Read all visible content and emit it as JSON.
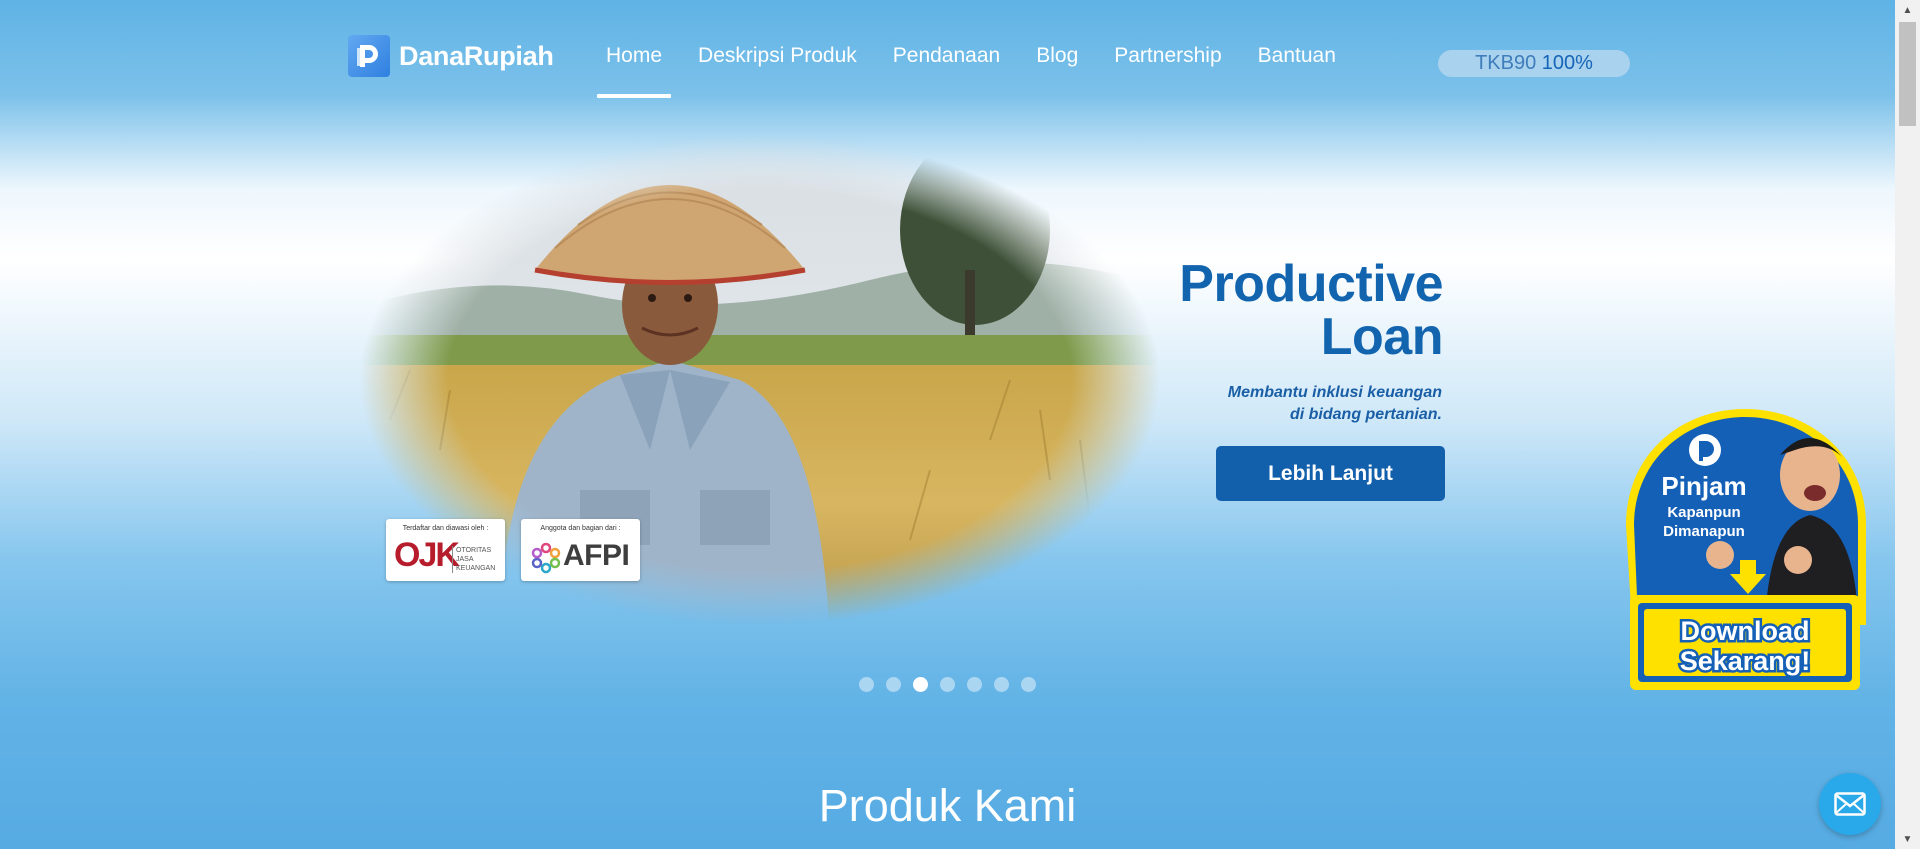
{
  "brand": {
    "name": "DanaRupiah"
  },
  "nav": {
    "items": [
      {
        "label": "Home",
        "active": true
      },
      {
        "label": "Deskripsi Produk",
        "active": false
      },
      {
        "label": "Pendanaan",
        "active": false
      },
      {
        "label": "Blog",
        "active": false
      },
      {
        "label": "Partnership",
        "active": false
      },
      {
        "label": "Bantuan",
        "active": false
      }
    ]
  },
  "tkb": {
    "label": "TKB90",
    "value": "100%"
  },
  "hero": {
    "title_line1": "Productive",
    "title_line2": "Loan",
    "subtitle_line1": "Membantu inklusi keuangan",
    "subtitle_line2": "di bidang pertanian.",
    "button_label": "Lebih Lanjut",
    "badges": {
      "ojk_caption": "Terdaftar dan diawasi oleh :",
      "ojk_logo": "OJK",
      "ojk_sub": "OTORITAS JASA KEUANGAN",
      "afpi_caption": "Anggota dan bagian dari :",
      "afpi_logo": "AFPI"
    }
  },
  "carousel": {
    "count": 7,
    "active_index": 2
  },
  "download_promo": {
    "line1": "Pinjam",
    "line2": "Kapanpun",
    "line3": "Dimanapun",
    "cta_line1": "Download",
    "cta_line2": "Sekarang!"
  },
  "section": {
    "title": "Produk Kami"
  },
  "colors": {
    "primary": "#1164ad",
    "button": "#1260ac",
    "sky": "#5fb3e5",
    "fab": "#29a9ea",
    "promo_yellow": "#ffe100"
  },
  "icons": {
    "mail": "mail-icon",
    "logo": "danarupiah-logo-icon"
  }
}
